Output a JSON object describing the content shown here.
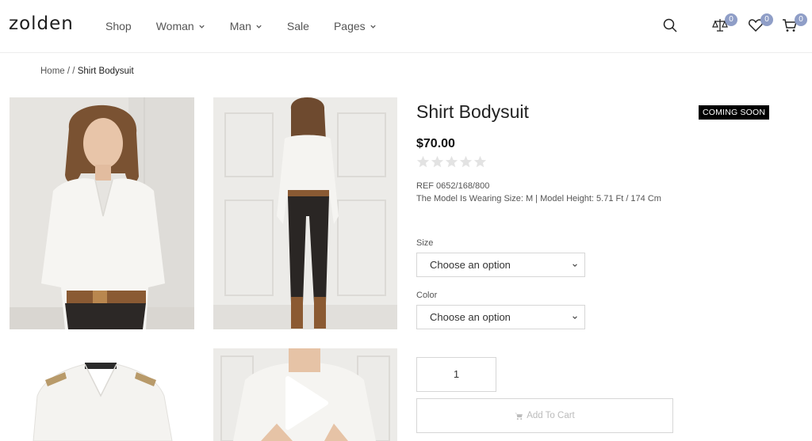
{
  "header": {
    "logo": "zolden",
    "nav": [
      {
        "label": "Shop",
        "dropdown": false
      },
      {
        "label": "Woman",
        "dropdown": true
      },
      {
        "label": "Man",
        "dropdown": true
      },
      {
        "label": "Sale",
        "dropdown": false
      },
      {
        "label": "Pages",
        "dropdown": true
      }
    ],
    "icons": {
      "search": "search-icon",
      "compare": "compare-icon",
      "wishlist": "heart-icon",
      "cart": "cart-icon"
    },
    "compare_count": "0",
    "wishlist_count": "0",
    "cart_count": "0",
    "badge_color": "#8f9ec7"
  },
  "breadcrumb": {
    "home": "Home",
    "sep1": "/",
    "sep2": "/",
    "current": "Shirt Bodysuit"
  },
  "product": {
    "title": "Shirt Bodysuit",
    "badge": "COMING SOON",
    "price": "$70.00",
    "rating": 0,
    "rating_max": 5,
    "ref": "REF 0652/168/800",
    "model_info": "The Model Is Wearing Size: M | Model Height: 5.71 Ft / 174 Cm",
    "size_label": "Size",
    "size_value": "Choose an option",
    "color_label": "Color",
    "color_value": "Choose an option",
    "quantity": "1",
    "add_to_cart": "Add To Cart"
  },
  "gallery": {
    "images": [
      "model-front-photo",
      "model-back-photo",
      "shirt-product-photo",
      "model-video-thumbnail"
    ]
  }
}
